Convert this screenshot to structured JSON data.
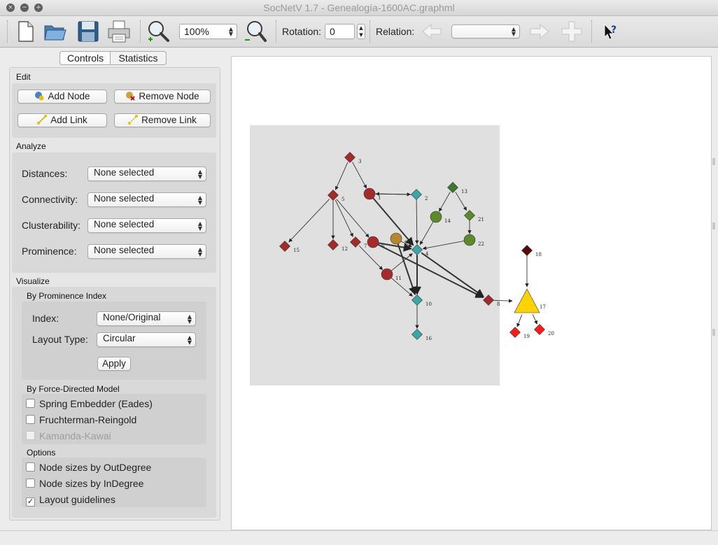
{
  "window": {
    "title": "SocNetV 1.7 - Genealogía-1600AC.graphml",
    "buttons": [
      "×",
      "−",
      "+"
    ]
  },
  "toolbar": {
    "icons": [
      "new-file-icon",
      "open-folder-icon",
      "save-disk-icon",
      "print-icon",
      "zoom-in-icon",
      "zoom-out-icon",
      "back-arrow-icon",
      "forward-arrow-icon",
      "add-plus-icon",
      "whats-this-help-icon"
    ],
    "zoom_value": "100%",
    "rotation_label": "Rotation:",
    "rotation_value": "0",
    "relation_label": "Relation:",
    "relation_value": ""
  },
  "tabs": [
    "Controls",
    "Statistics"
  ],
  "edit": {
    "label": "Edit",
    "add_node": "Add Node",
    "remove_node": "Remove Node",
    "add_link": "Add Link",
    "remove_link": "Remove Link"
  },
  "analyze": {
    "label": "Analyze",
    "rows": [
      {
        "label": "Distances:",
        "value": "None selected"
      },
      {
        "label": "Connectivity:",
        "value": "None selected"
      },
      {
        "label": "Clusterability:",
        "value": "None selected"
      },
      {
        "label": "Prominence:",
        "value": "None selected"
      }
    ]
  },
  "visualize": {
    "label": "Visualize",
    "prominence_label": "By Prominence Index",
    "index_label": "Index:",
    "index_value": "None/Original",
    "layout_label": "Layout Type:",
    "layout_value": "Circular",
    "apply": "Apply",
    "force_label": "By Force-Directed Model",
    "force_options": [
      {
        "label": "Spring Embedder (Eades)",
        "checked": false,
        "enabled": true
      },
      {
        "label": "Fruchterman-Reingold",
        "checked": false,
        "enabled": true
      },
      {
        "label": "Kamanda-Kawai",
        "checked": false,
        "enabled": false
      }
    ],
    "options_label": "Options",
    "options": [
      {
        "label": "Node sizes by OutDegree",
        "checked": false
      },
      {
        "label": "Node sizes by InDegree",
        "checked": false
      },
      {
        "label": "Layout guidelines",
        "checked": true
      }
    ]
  },
  "graph": {
    "colors": {
      "darkred": "#a52a2a",
      "teal": "#3aa7a7",
      "green": "#3a7a2a",
      "olive": "#5a8a2a",
      "gold": "#b8862b",
      "maroon": "#5a0a0a",
      "red": "#ff1a1a",
      "yellow": "#ffd200"
    },
    "nodes": [
      {
        "id": "1",
        "shape": "circle",
        "color": "darkred"
      },
      {
        "id": "2",
        "shape": "diamond",
        "color": "teal"
      },
      {
        "id": "3",
        "shape": "diamond",
        "color": "darkred"
      },
      {
        "id": "4",
        "shape": "diamond",
        "color": "teal"
      },
      {
        "id": "5",
        "shape": "diamond",
        "color": "darkred"
      },
      {
        "id": "6",
        "shape": "circle",
        "color": "darkred"
      },
      {
        "id": "7",
        "shape": "diamond",
        "color": "darkred"
      },
      {
        "id": "8",
        "shape": "diamond",
        "color": "darkred"
      },
      {
        "id": "9",
        "shape": "circle",
        "color": "gold"
      },
      {
        "id": "10",
        "shape": "diamond",
        "color": "teal"
      },
      {
        "id": "11",
        "shape": "circle",
        "color": "darkred"
      },
      {
        "id": "12",
        "shape": "diamond",
        "color": "darkred"
      },
      {
        "id": "13",
        "shape": "diamond",
        "color": "green"
      },
      {
        "id": "14",
        "shape": "circle",
        "color": "olive"
      },
      {
        "id": "15",
        "shape": "diamond",
        "color": "darkred"
      },
      {
        "id": "16",
        "shape": "diamond",
        "color": "teal"
      },
      {
        "id": "17",
        "shape": "triangle",
        "color": "yellow"
      },
      {
        "id": "18",
        "shape": "diamond",
        "color": "maroon"
      },
      {
        "id": "19",
        "shape": "diamond",
        "color": "red"
      },
      {
        "id": "20",
        "shape": "diamond",
        "color": "red"
      },
      {
        "id": "21",
        "shape": "diamond",
        "color": "olive"
      },
      {
        "id": "22",
        "shape": "circle",
        "color": "olive"
      }
    ],
    "edges": [
      [
        "3",
        "5"
      ],
      [
        "3",
        "1"
      ],
      [
        "1",
        "2"
      ],
      [
        "2",
        "1"
      ],
      [
        "1",
        "4"
      ],
      [
        "5",
        "15"
      ],
      [
        "5",
        "12"
      ],
      [
        "5",
        "7"
      ],
      [
        "5",
        "6"
      ],
      [
        "7",
        "11"
      ],
      [
        "6",
        "4"
      ],
      [
        "6",
        "8"
      ],
      [
        "9",
        "10"
      ],
      [
        "9",
        "4"
      ],
      [
        "11",
        "4"
      ],
      [
        "11",
        "10"
      ],
      [
        "4",
        "10"
      ],
      [
        "4",
        "8"
      ],
      [
        "2",
        "4"
      ],
      [
        "10",
        "16"
      ],
      [
        "13",
        "14"
      ],
      [
        "13",
        "21"
      ],
      [
        "14",
        "4"
      ],
      [
        "21",
        "22"
      ],
      [
        "22",
        "4"
      ],
      [
        "8",
        "17"
      ],
      [
        "18",
        "17"
      ],
      [
        "17",
        "19"
      ],
      [
        "17",
        "20"
      ]
    ]
  }
}
